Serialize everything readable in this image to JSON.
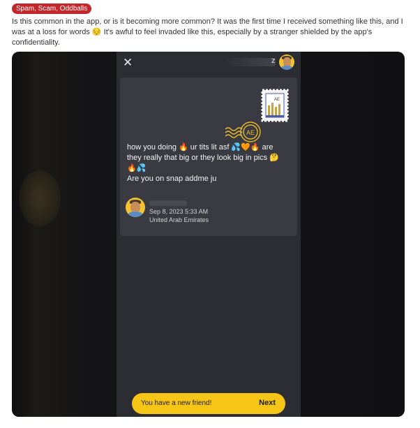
{
  "post": {
    "flair": "Spam, Scam, Oddballs",
    "body": "Is this common in the app, or is it becoming more common? It was the first time I received something like this, and I was at a loss for words 😔 It's awful to feel invaded like this, especially by a stranger shielded by the app's confidentiality."
  },
  "app": {
    "close_glyph": "✕",
    "header_name_suffix": "z",
    "stamp_country_code": "AE",
    "message_lines": [
      "how you doing 🔥 ur tits lit asf 💦🧡🔥 are",
      "they really that big or they look big in pics 🤔",
      "🔥💦",
      "Are you on snap addme ju"
    ],
    "sent_date": "Sep 8, 2023 5:33 AM",
    "location": "United Arab Emirates",
    "cta_text": "You have a new friend!",
    "cta_button": "Next"
  },
  "colors": {
    "flair_bg": "#c3272b",
    "cta_bg": "#f7c515",
    "phone_bg": "#2c2d33",
    "card_bg": "#3a3b42"
  }
}
